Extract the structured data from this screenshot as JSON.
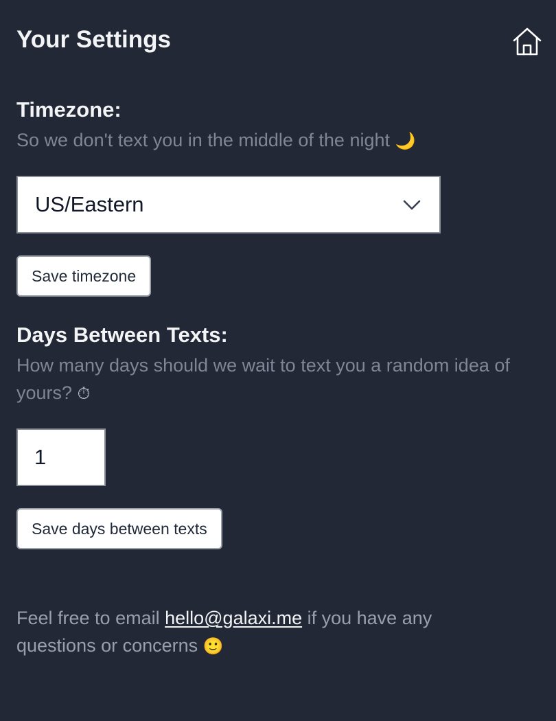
{
  "header": {
    "title": "Your Settings",
    "home_icon": "home-icon"
  },
  "timezone": {
    "heading": "Timezone:",
    "hint": "So we don't text you in the middle of the night",
    "hint_emoji": "🌙",
    "selected_value": "US/Eastern",
    "select_icon": "chevron-down-icon",
    "save_label": "Save timezone"
  },
  "days_between": {
    "heading": "Days Between Texts:",
    "hint": "How many days should we wait to text you a random idea of yours?",
    "hint_emoji": "⏱",
    "value": "1",
    "save_label": "Save days between texts"
  },
  "footer": {
    "text_before": "Feel free to email ",
    "email": "hello@galaxi.me",
    "text_after": " if you have any questions or concerns",
    "emoji": "🙂"
  },
  "colors": {
    "background": "#222836",
    "heading_text": "#f3f4f6",
    "hint_text": "#7f8695",
    "control_bg": "#ffffff"
  }
}
